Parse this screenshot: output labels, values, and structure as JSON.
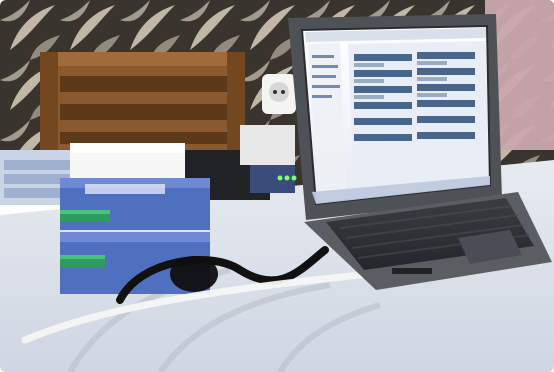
{
  "scene": {
    "subject": "desk-with-laptop-and-network-equipment",
    "colors": {
      "wallpaper_dark": "#3a342e",
      "wallpaper_light": "#cfc6b4",
      "wall_pink": "#c9a8ae",
      "cloth": "#dfe3ea",
      "cloth_shadow": "#b9c0cc",
      "crate": "#8a5a2e",
      "crate_dark": "#5c3918",
      "laptop_body": "#5a5d62",
      "laptop_dark": "#2c2e33",
      "screen_bg": "#f2f4f7",
      "screen_accent": "#2f4f7a",
      "blue_box": "#4f6fbf",
      "blue_box_dark": "#3b56a0",
      "green_terminal": "#2f9b5f",
      "led_green": "#7dff6a"
    }
  }
}
